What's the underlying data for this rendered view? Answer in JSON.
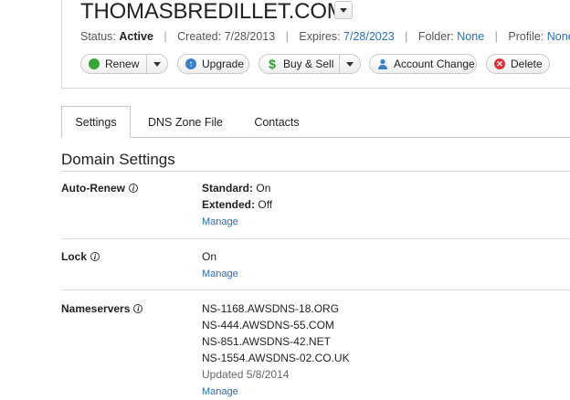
{
  "domain": {
    "name": "THOMASBREDILLET.COM",
    "status_label": "Status:",
    "status_value": "Active",
    "created": "Created: 7/28/2013",
    "expires_label": "Expires:",
    "expires_value": "7/28/2023",
    "folder_label": "Folder:",
    "folder_value": "None",
    "profile_label": "Profile:",
    "profile_value": "None"
  },
  "actions": {
    "renew": "Renew",
    "upgrade": "Upgrade",
    "buy_sell": "Buy & Sell",
    "account_change": "Account Change",
    "delete": "Delete"
  },
  "tabs": [
    "Settings",
    "DNS Zone File",
    "Contacts"
  ],
  "section_title": "Domain Settings",
  "settings": {
    "autorenew": {
      "label": "Auto-Renew",
      "standard_label": "Standard:",
      "standard_value": "On",
      "extended_label": "Extended:",
      "extended_value": "Off",
      "manage": "Manage"
    },
    "lock": {
      "label": "Lock",
      "value": "On",
      "manage": "Manage"
    },
    "nameservers": {
      "label": "Nameservers",
      "list": [
        "NS-1168.AWSDNS-18.ORG",
        "NS-444.AWSDNS-55.COM",
        "NS-851.AWSDNS-42.NET",
        "NS-1554.AWSDNS-02.CO.UK"
      ],
      "updated": "Updated 5/8/2014",
      "manage": "Manage"
    }
  },
  "icons": {
    "renew": "green-circle-icon",
    "upgrade": "blue-up-arrow-icon",
    "buy_sell": "dollar-icon",
    "account_change": "person-icon",
    "delete": "red-x-icon"
  },
  "colors": {
    "link": "#2a6ebb",
    "renew_icon": "#3aa53a",
    "upgrade_icon": "#3b7fc4",
    "delete_icon": "#d9343a"
  }
}
